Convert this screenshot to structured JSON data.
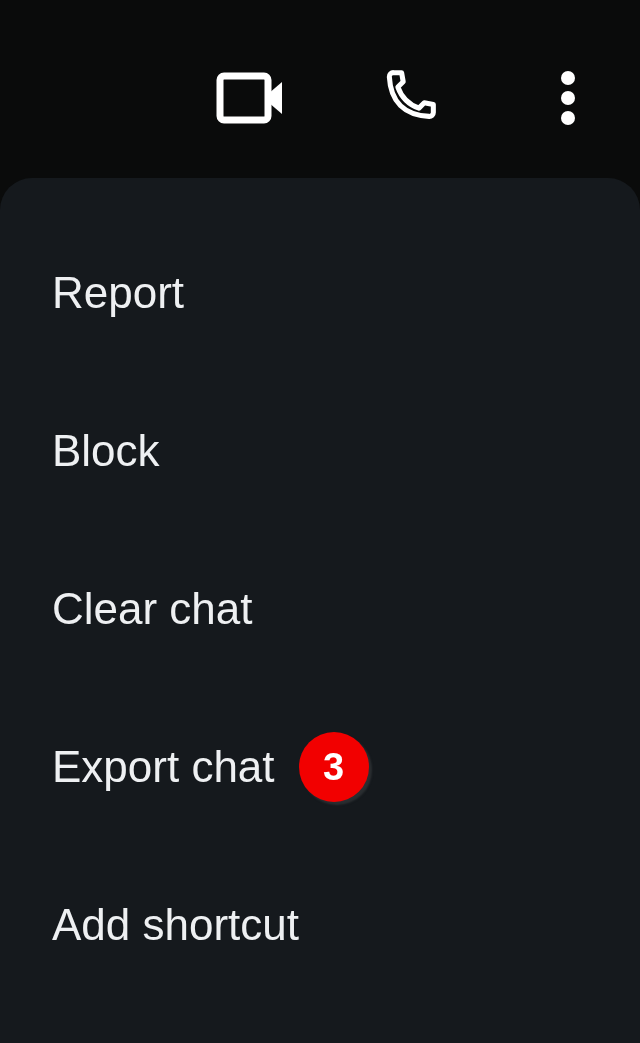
{
  "toolbar": {
    "actions": [
      {
        "kind": "video"
      },
      {
        "kind": "call"
      },
      {
        "kind": "more"
      }
    ]
  },
  "menu": {
    "items": [
      {
        "label": "Report"
      },
      {
        "label": "Block"
      },
      {
        "label": "Clear chat"
      },
      {
        "label": "Export chat",
        "badge": "3"
      },
      {
        "label": "Add shortcut"
      }
    ]
  }
}
